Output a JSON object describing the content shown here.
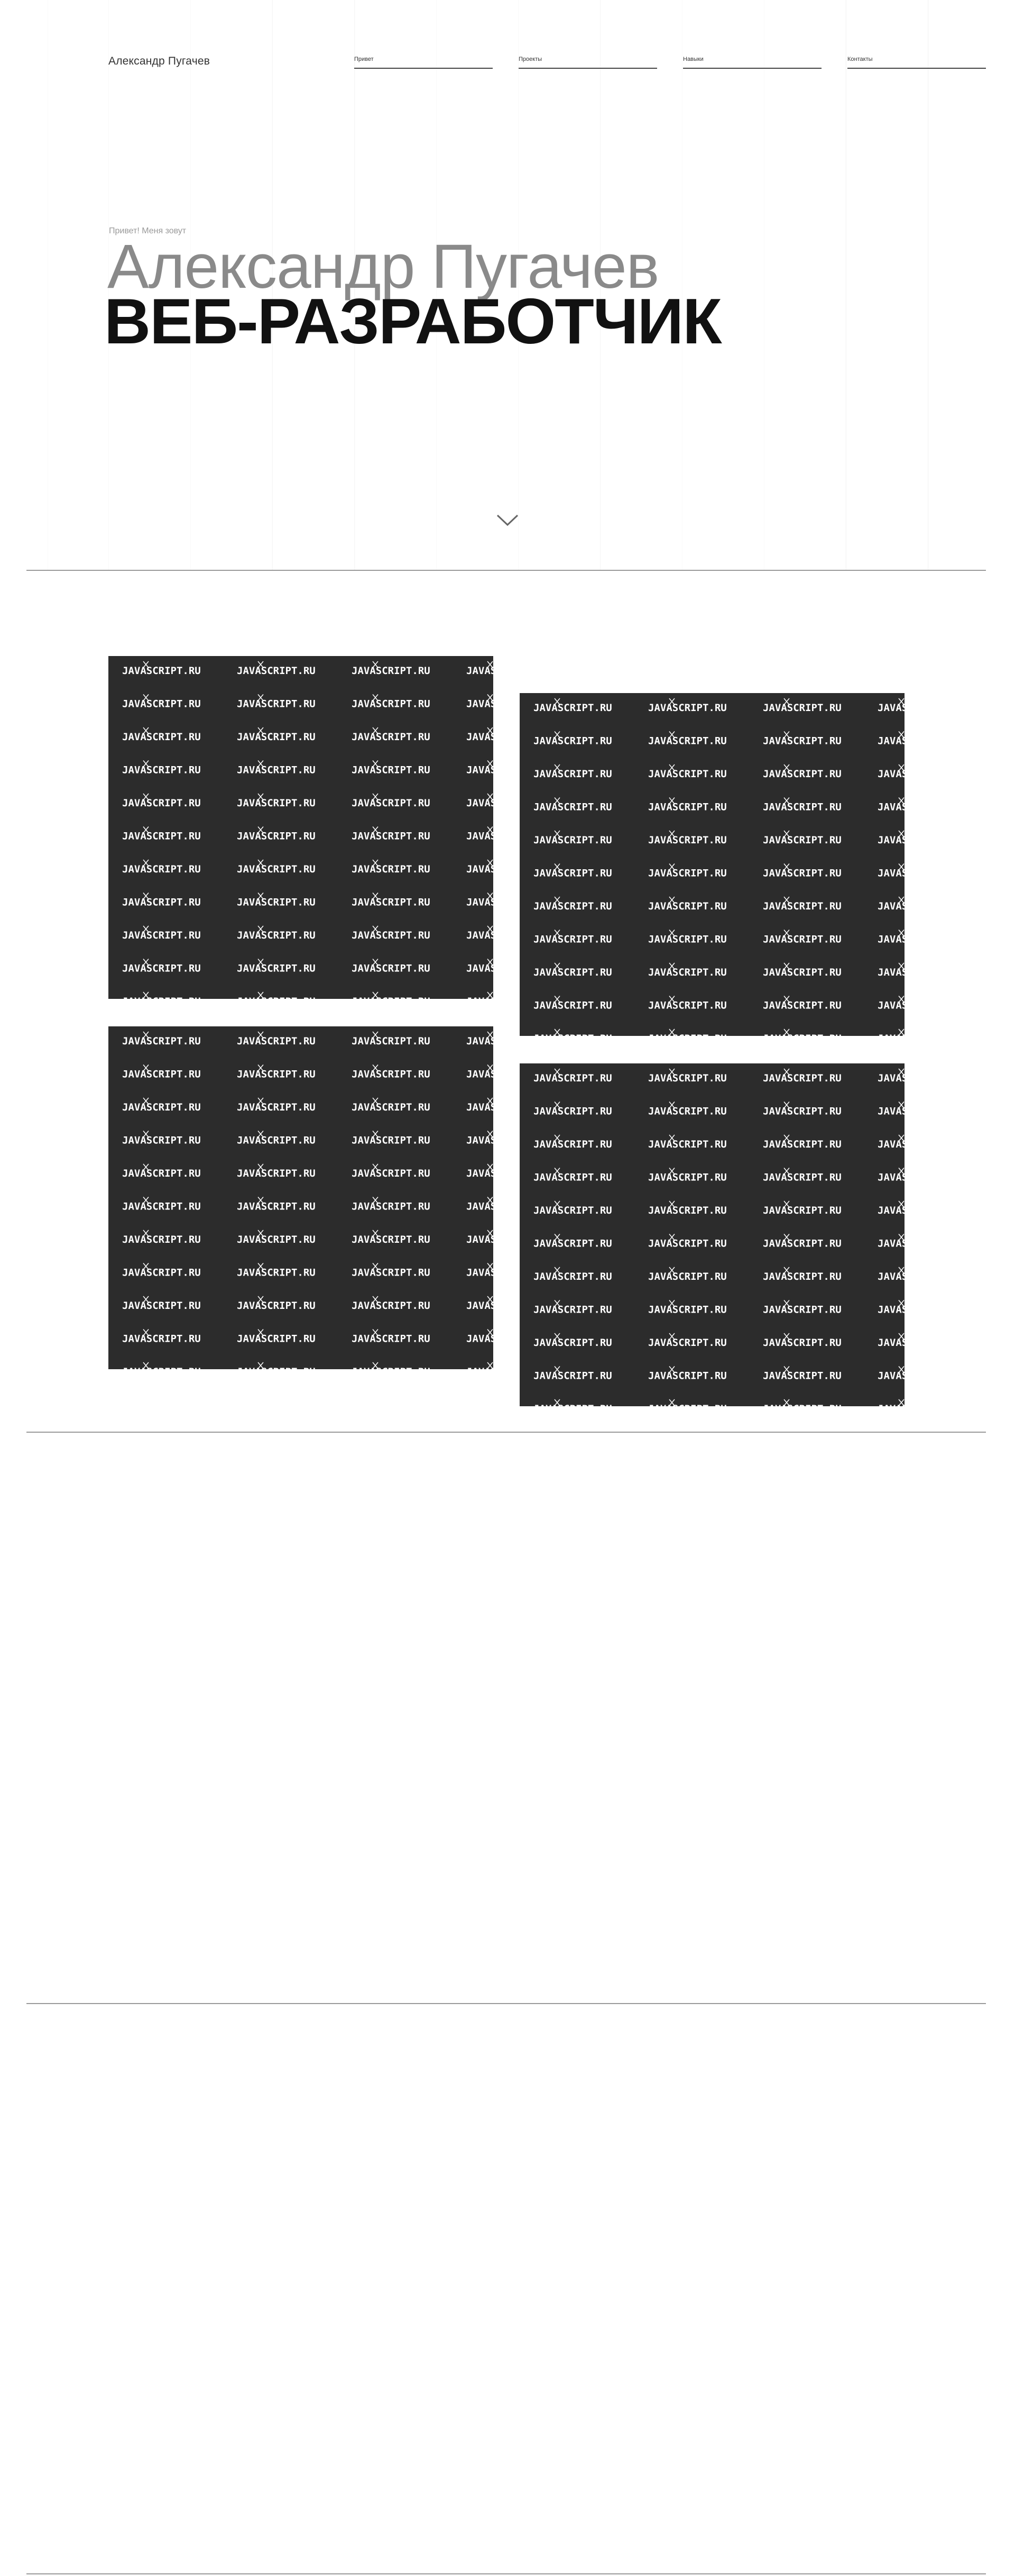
{
  "header": {
    "logo": "Александр Пугачев",
    "nav": [
      {
        "label": "Привет"
      },
      {
        "label": "Проекты"
      },
      {
        "label": "Навыки"
      },
      {
        "label": "Контакты"
      }
    ]
  },
  "hero": {
    "greeting": "Привет! Меня зовут",
    "name": "Александр Пугачев",
    "title": "ВЕБ-РАЗРАБОТЧИК",
    "scroll_icon": "chevron-down-icon"
  },
  "projects": {
    "pattern_text": "JAVASCRIPT.RU",
    "items": [
      {
        "label": "JAVASCRIPT.RU"
      },
      {
        "label": "JAVASCRIPT.RU"
      },
      {
        "label": "JAVASCRIPT.RU"
      },
      {
        "label": "JAVASCRIPT.RU"
      }
    ]
  },
  "colors": {
    "card_background": "#2c2c2c",
    "card_text": "#ffffff",
    "divider": "#9a9a9a",
    "hero_name": "#8a8a8a",
    "hero_title": "#111111"
  }
}
